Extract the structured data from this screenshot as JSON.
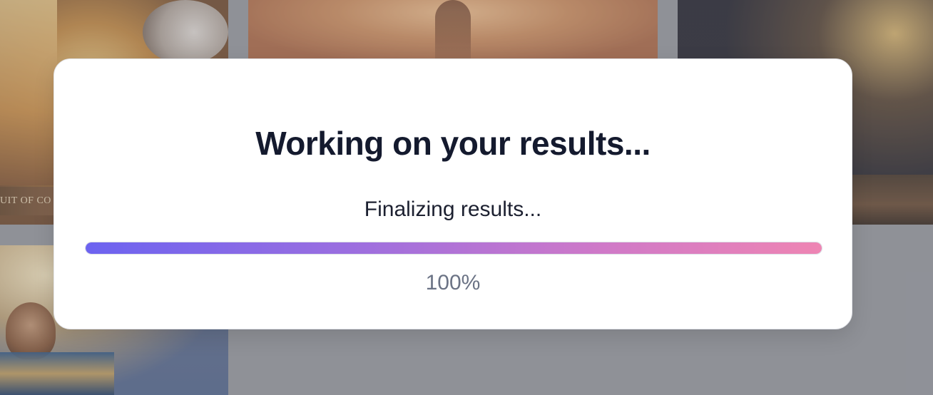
{
  "background": {
    "cards": [
      {
        "caption": "UIT OF CO"
      },
      {
        "caption": ""
      },
      {
        "caption": ""
      },
      {
        "caption": ""
      }
    ]
  },
  "modal": {
    "title": "Working on your results...",
    "status": "Finalizing results...",
    "progress": {
      "percent": 100,
      "label": "100%"
    }
  },
  "colors": {
    "title_text": "#141a2e",
    "progress_start": "#6c63f0",
    "progress_end": "#ee85b3",
    "percent_text": "#6b7385"
  }
}
